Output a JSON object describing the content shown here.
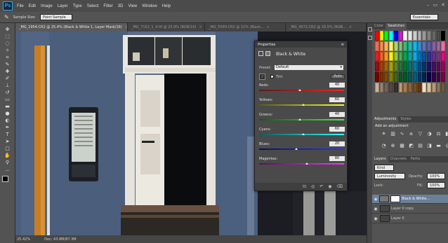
{
  "app": {
    "logo": "Ps"
  },
  "menu": [
    "File",
    "Edit",
    "Image",
    "Layer",
    "Type",
    "Select",
    "Filter",
    "3D",
    "View",
    "Window",
    "Help"
  ],
  "window_controls": {
    "minimize": "–",
    "maximize": "▭",
    "close": "✕"
  },
  "options": {
    "sample_size_label": "Sample Size:",
    "sample_size_value": "Point Sample",
    "workspace": "Essentials"
  },
  "tabs": [
    {
      "label": "_MG_1954.CR2 @ 25.4% (Black & White 1, Layer Mask/16)",
      "active": true
    },
    {
      "label": "_MG_7152_1_4.tif @ 25.9% (RGB/16)",
      "active": false
    },
    {
      "label": "_MG_5099.CR2 @ 11% (Black...",
      "active": false
    },
    {
      "label": "_MG_4572.CR2 @ 16.5% (RGB...",
      "active": false
    }
  ],
  "tab_close": "×",
  "status": {
    "zoom": "25.42%",
    "doc": "Doc: 43.8M/87.3M"
  },
  "right_top_tabs": {
    "color": "Color",
    "swatches": "Swatches"
  },
  "swatch_colors": [
    "#ff0000",
    "#ffff00",
    "#00ff00",
    "#00ffff",
    "#0000ff",
    "#ff00ff",
    "#ffffff",
    "#e6e6e6",
    "#cccccc",
    "#b3b3b3",
    "#999999",
    "#808080",
    "#666666",
    "#4d4d4d",
    "#000000",
    "#f26c4f",
    "#f68e55",
    "#fbaf5c",
    "#fff467",
    "#acd372",
    "#7cc576",
    "#3bb878",
    "#1abbb4",
    "#00bff3",
    "#438ccb",
    "#5574b9",
    "#605ca8",
    "#855fa8",
    "#a763a8",
    "#f06ea9",
    "#ed1c24",
    "#f26522",
    "#f7941d",
    "#fff200",
    "#8dc63f",
    "#39b54a",
    "#00a651",
    "#00a99d",
    "#00aeef",
    "#0072bc",
    "#0054a6",
    "#2e3192",
    "#662d91",
    "#92278f",
    "#ec008c",
    "#9e0b0f",
    "#a0410d",
    "#a3620a",
    "#aba000",
    "#598527",
    "#1a7b30",
    "#007236",
    "#00746b",
    "#0076a3",
    "#004b80",
    "#003471",
    "#1b1464",
    "#440e62",
    "#630460",
    "#9e005d",
    "#790000",
    "#7b2e00",
    "#7d4900",
    "#827b00",
    "#406618",
    "#005e20",
    "#005826",
    "#005952",
    "#005b7f",
    "#003663",
    "#002157",
    "#0d004c",
    "#32004b",
    "#4b0049",
    "#7b0046",
    "#c7b299",
    "#998675",
    "#736357",
    "#534741",
    "#37302d",
    "#c69c6d",
    "#a67c52",
    "#8c6239",
    "#754c24",
    "#603913",
    "#f5e0c0",
    "#d9c29a",
    "#b59b74",
    "#8f7a57",
    "#6b5a3f"
  ],
  "adjustments": {
    "tabs": [
      "Adjustments",
      "Styles"
    ],
    "hint": "Add an adjustment"
  },
  "adjustment_icons": [
    "brightness-icon",
    "levels-icon",
    "curves-icon",
    "exposure-icon",
    "vibrance-icon",
    "hue-saturation-icon",
    "color-balance-icon",
    "black-white-icon",
    "photo-filter-icon",
    "channel-mixer-icon",
    "color-lookup-icon",
    "invert-icon",
    "posterize-icon",
    "threshold-icon",
    "gradient-map-icon",
    "selective-color-icon"
  ],
  "layers": {
    "tabs": [
      "Layers",
      "Channels",
      "Paths"
    ],
    "kind": "Kind",
    "blend": "Luminosity",
    "opacity_label": "Opacity:",
    "opacity": "100%",
    "lock_label": "Lock:",
    "fill_label": "Fill:",
    "fill": "100%",
    "items": [
      {
        "name": "Black & White...",
        "selected": true
      },
      {
        "name": "Layer 0 copy",
        "selected": false
      },
      {
        "name": "Layer 0",
        "selected": false
      }
    ]
  },
  "properties": {
    "panel_title": "Properties",
    "title": "Black & White",
    "preset_label": "Preset:",
    "preset_value": "Default",
    "tint_label": "Tint",
    "auto": "Auto",
    "sliders": [
      {
        "label": "Reds:",
        "value": 40,
        "gradient": "linear-gradient(90deg,#5a1a1a,#ff2020)"
      },
      {
        "label": "Yellows:",
        "value": 60,
        "gradient": "linear-gradient(90deg,#5a5a10,#ffff30)"
      },
      {
        "label": "Greens:",
        "value": 40,
        "gradient": "linear-gradient(90deg,#105a10,#30ff30)"
      },
      {
        "label": "Cyans:",
        "value": 60,
        "gradient": "linear-gradient(90deg,#105a5a,#30ffff)"
      },
      {
        "label": "Blues:",
        "value": 20,
        "gradient": "linear-gradient(90deg,#10105a,#3030ff)"
      },
      {
        "label": "Magentas:",
        "value": 80,
        "gradient": "linear-gradient(90deg,#5a105a,#ff30ff)"
      }
    ]
  }
}
